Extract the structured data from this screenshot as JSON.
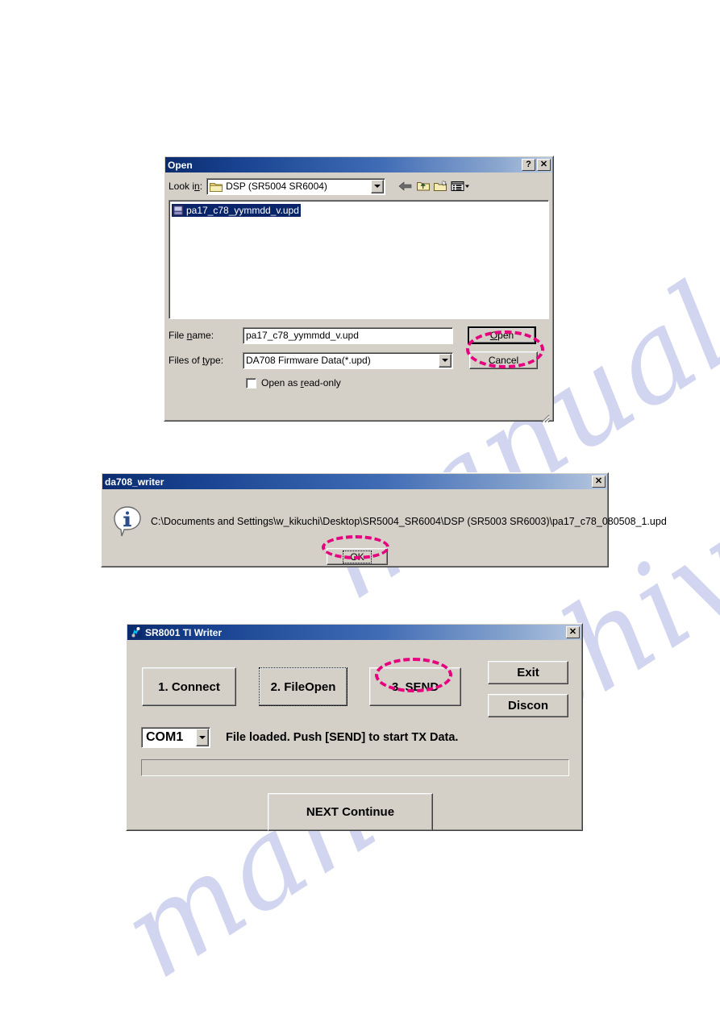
{
  "watermark": {
    "text": "manualshive.com"
  },
  "open_dialog": {
    "title": "Open",
    "help_button": "?",
    "close_button": "✕",
    "look_in_label": "Look in:",
    "look_in_value": "DSP (SR5004 SR6004)",
    "toolbar": {
      "back": "back-arrow",
      "up": "up-one-level",
      "new_folder": "create-new-folder",
      "views": "views-menu"
    },
    "files": [
      {
        "name": "pa17_c78_yymmdd_v.upd",
        "selected": true
      }
    ],
    "file_name_label": "File name:",
    "file_name_label_parts": {
      "pre": "File ",
      "accel": "n",
      "post": "ame:"
    },
    "file_name_value": "pa17_c78_yymmdd_v.upd",
    "files_of_type_label_parts": {
      "pre": "Files of ",
      "accel": "t",
      "post": "ype:"
    },
    "files_of_type_value": "DA708 Firmware Data(*.upd)",
    "read_only_label_parts": {
      "pre": "Open as ",
      "accel": "r",
      "post": "ead-only"
    },
    "read_only_checked": false,
    "open_button_parts": {
      "accel": "O",
      "post": "pen"
    },
    "cancel_button": "Cancel"
  },
  "message_dialog": {
    "title": "da708_writer",
    "close_button": "✕",
    "icon": "information-icon",
    "message": "C:\\Documents and Settings\\w_kikuchi\\Desktop\\SR5004_SR6004\\DSP (SR5003 SR6003)\\pa17_c78_080508_1.upd",
    "ok_button": "OK"
  },
  "writer_dialog": {
    "title": "SR8001 TI Writer",
    "close_button": "✕",
    "connect_button": "1. Connect",
    "fileopen_button": "2. FileOpen",
    "send_button": "3. SEND",
    "exit_button": "Exit",
    "discon_button": "Discon",
    "com_port": "COM1",
    "status_text": "File loaded. Push [SEND] to start TX Data.",
    "progress_value": 0,
    "next_button": "NEXT Continue"
  },
  "annotations": {
    "color": "#E6007E",
    "targets": [
      "open-button",
      "ok-button",
      "send-button"
    ]
  }
}
